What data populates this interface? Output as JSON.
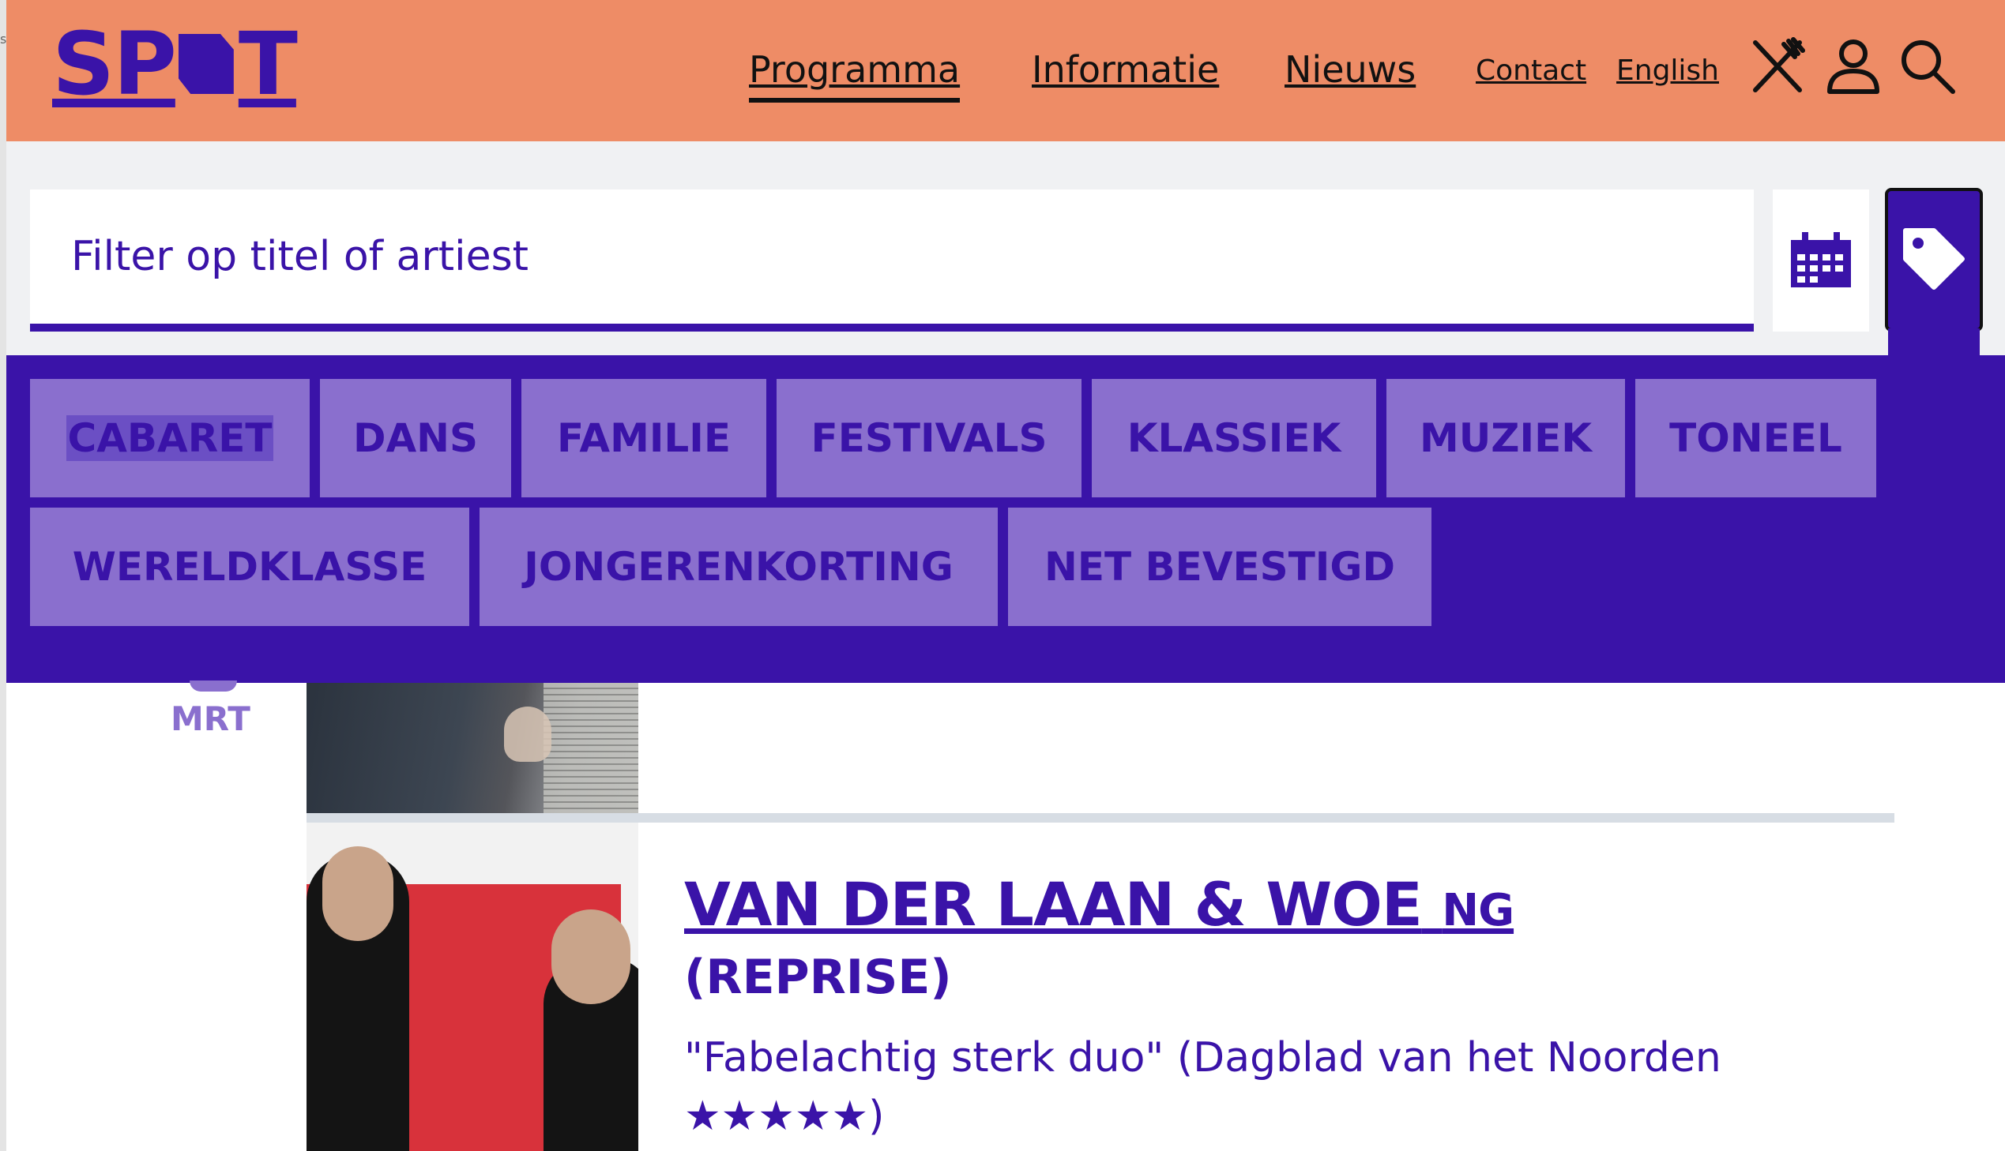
{
  "header": {
    "logo_text_left": "SP",
    "logo_text_right": "T",
    "nav": [
      "Programma",
      "Informatie",
      "Nieuws"
    ],
    "contact": "Contact",
    "language": "English",
    "icons": [
      "restaurant-icon",
      "user-icon",
      "search-icon"
    ]
  },
  "search": {
    "placeholder": "Filter op titel of artiest",
    "calendar_icon": "calendar-icon",
    "tag_icon": "tag-icon"
  },
  "filters": {
    "row1": [
      "CABARET",
      "DANS",
      "FAMILIE",
      "FESTIVALS",
      "KLASSIEK",
      "MUZIEK",
      "TONEEL"
    ],
    "row2": [
      "WERELDKLASSE",
      "JONGERENKORTING",
      "NET BEVESTIGD"
    ]
  },
  "events": {
    "month": "MRT",
    "item": {
      "title_main": "VAN DER LAAN & WOE",
      "title_small": "NG",
      "subtitle": "(REPRISE)",
      "quote": "\"Fabelachtig sterk duo\" (Dagblad van het Noorden",
      "rating": "★★★★★)"
    }
  },
  "colors": {
    "header_bg": "#ee8c66",
    "brand_purple": "#3a13a8",
    "chip_bg": "#8a6fce",
    "page_bg": "#f0f1f3"
  }
}
